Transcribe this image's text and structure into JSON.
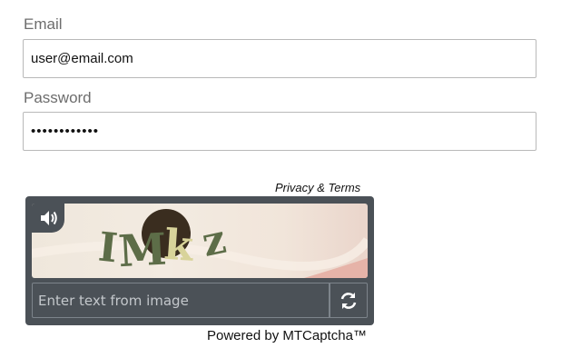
{
  "form": {
    "email_label": "Email",
    "email_value": "user@email.com",
    "password_label": "Password",
    "password_value": "••••••••••••"
  },
  "captcha": {
    "privacy_terms": "Privacy & Terms",
    "image_text": "IMkz",
    "input_placeholder": "Enter text from image",
    "powered_by": "Powered by MTCaptcha™",
    "audio_icon": "speaker-icon",
    "refresh_icon": "refresh-icon",
    "colors": {
      "panel": "#4b5157",
      "text_on_image": "#5b6b4a"
    }
  }
}
